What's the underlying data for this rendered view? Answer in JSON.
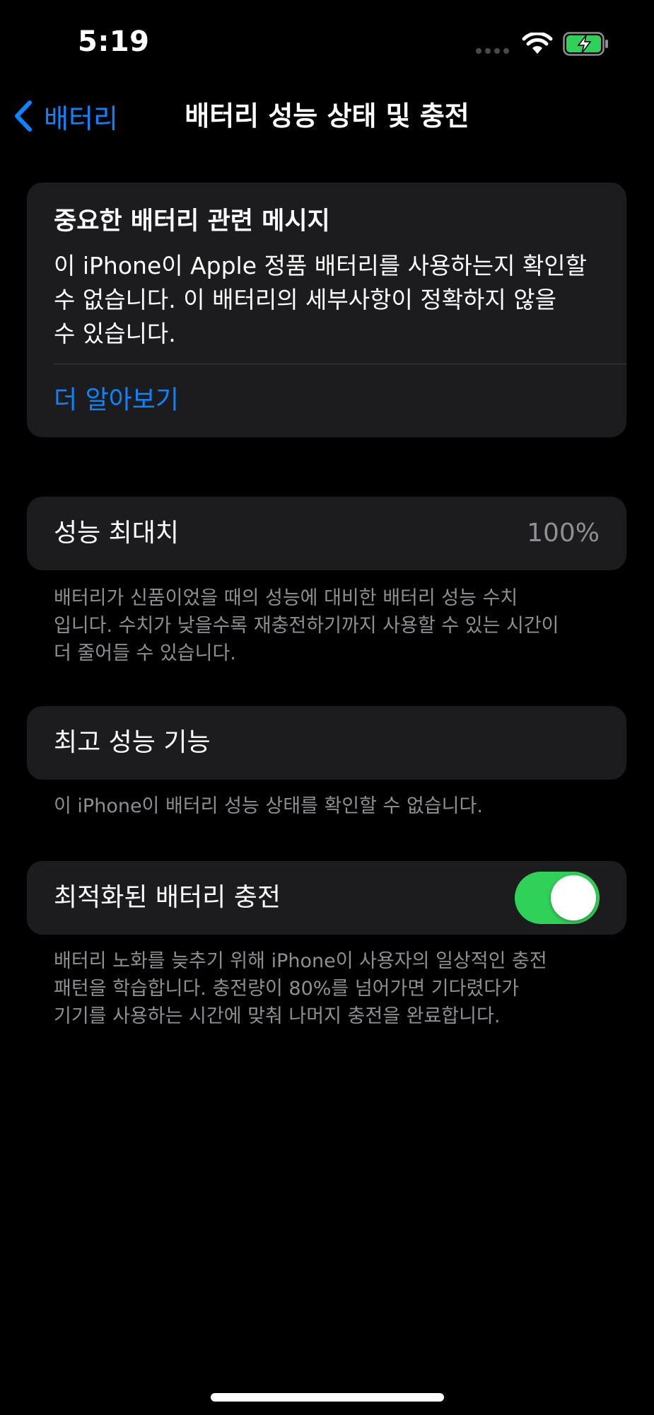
{
  "status_bar": {
    "time": "5:19",
    "battery_color": "#30d158"
  },
  "nav": {
    "back_label": "배터리",
    "title": "배터리 성능 상태 및 충전",
    "accent_color": "#0a84ff"
  },
  "alert": {
    "title": "중요한 배터리 관련 메시지",
    "body": "이 iPhone이 Apple 정품 배터리를 사용하는지 확인할\n수 없습니다. 이 배터리의 세부사항이 정확하지 않을\n수 있습니다.",
    "link_label": "더 알아보기"
  },
  "peak_capacity": {
    "label": "성능 최대치",
    "value": "100%",
    "footnote": "배터리가 신품이었을 때의 성능에 대비한 배터리 성능 수치\n입니다. 수치가 낮을수록 재충전하기까지 사용할 수 있는 시간이\n더 줄어들 수 있습니다."
  },
  "peak_performance": {
    "label": "최고 성능 기능",
    "footnote": "이 iPhone이 배터리 성능 상태를 확인할 수 없습니다."
  },
  "optimized_charging": {
    "label": "최적화된 배터리 충전",
    "enabled": true,
    "toggle_color": "#30d158",
    "footnote": "배터리 노화를 늦추기 위해 iPhone이 사용자의 일상적인 충전\n패턴을 학습합니다. 충전량이 80%를 넘어가면 기다렸다가\n기기를 사용하는 시간에 맞춰 나머지 충전을 완료합니다."
  },
  "icons": {
    "back": "chevron-left-icon",
    "wifi": "wifi-icon",
    "battery": "battery-charging-icon",
    "signal": "signal-dots-icon"
  }
}
